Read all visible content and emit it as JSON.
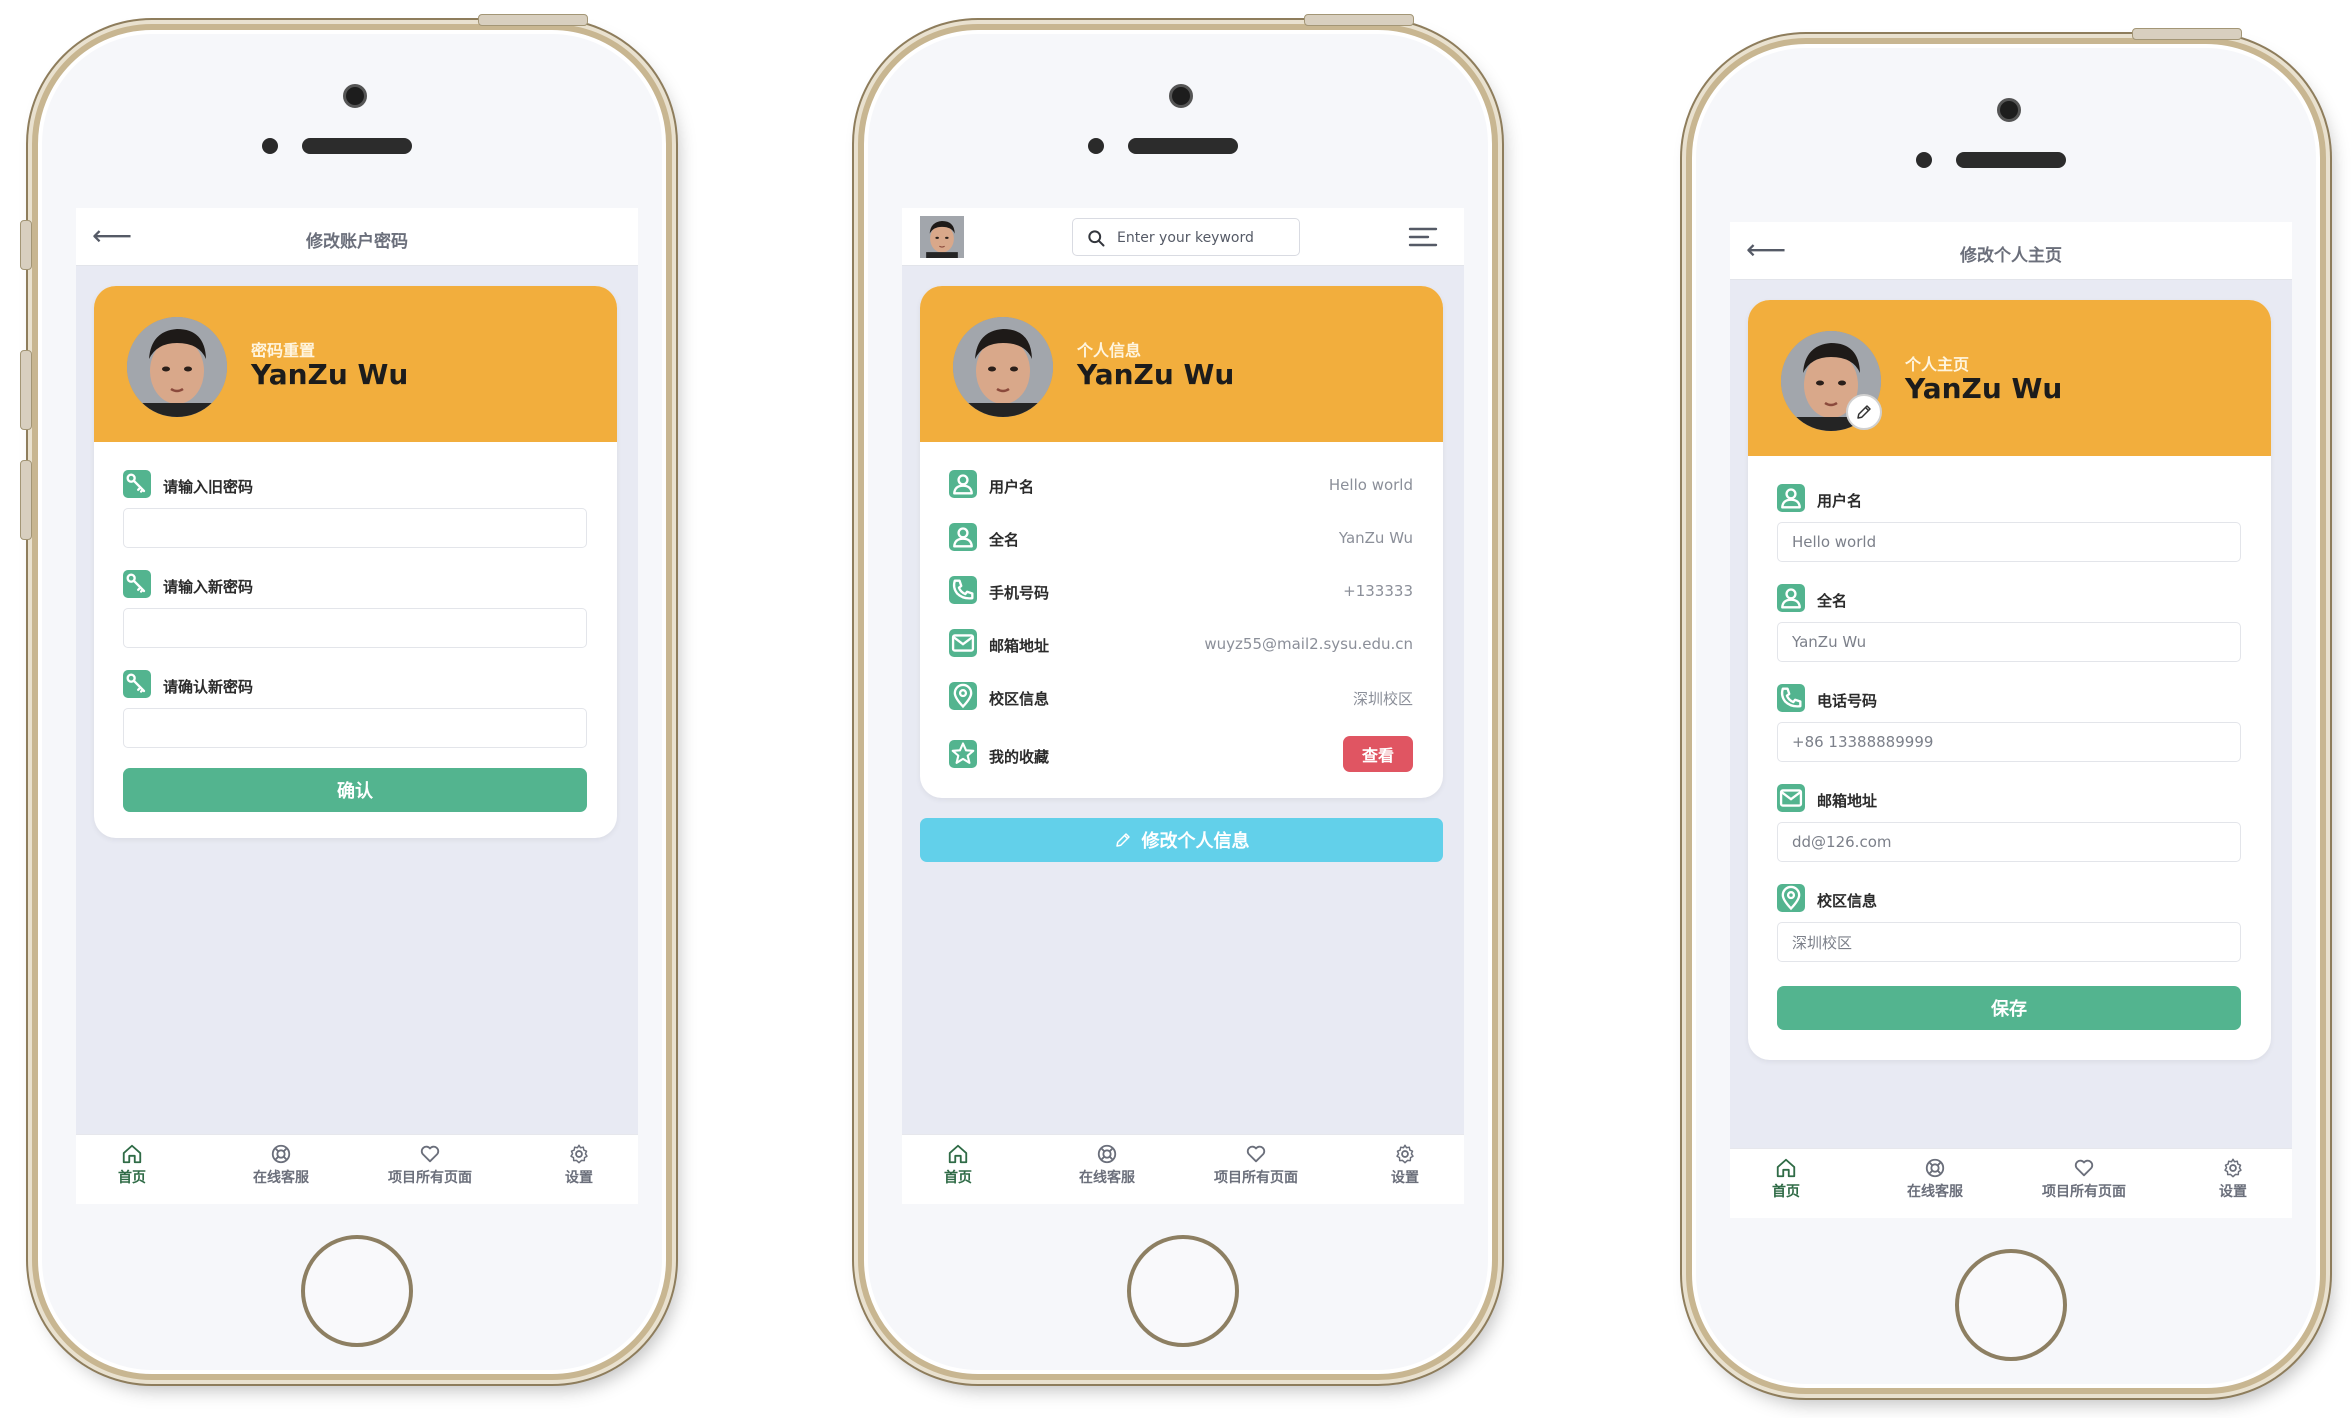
{
  "tabs": [
    {
      "label": "首页",
      "icon": "home-icon"
    },
    {
      "label": "在线客服",
      "icon": "support-icon"
    },
    {
      "label": "项目所有页面",
      "icon": "heart-icon"
    },
    {
      "label": "设置",
      "icon": "gear-icon"
    }
  ],
  "phone1": {
    "title": "修改账户密码",
    "header_sub": "密码重置",
    "name": "YanZu Wu",
    "fields": [
      {
        "label": "请输入旧密码",
        "value": ""
      },
      {
        "label": "请输入新密码",
        "value": ""
      },
      {
        "label": "请确认新密码",
        "value": ""
      }
    ],
    "confirm_label": "确认"
  },
  "phone2": {
    "search_placeholder": "Enter your keyword",
    "header_sub": "个人信息",
    "name": "YanZu Wu",
    "rows": [
      {
        "label": "用户名",
        "value": "Hello world",
        "icon": "user-icon"
      },
      {
        "label": "全名",
        "value": "YanZu Wu",
        "icon": "user-icon"
      },
      {
        "label": "手机号码",
        "value": "+133333",
        "icon": "phone-icon"
      },
      {
        "label": "邮箱地址",
        "value": "wuyz55@mail2.sysu.edu.cn",
        "icon": "mail-icon"
      },
      {
        "label": "校区信息",
        "value": "深圳校区",
        "icon": "location-icon"
      },
      {
        "label": "我的收藏",
        "value": "",
        "icon": "star-icon"
      }
    ],
    "view_label": "查看",
    "edit_label": "修改个人信息"
  },
  "phone3": {
    "title": "修改个人主页",
    "header_sub": "个人主页",
    "name": "YanZu Wu",
    "fields": [
      {
        "label": "用户名",
        "value": "Hello world",
        "icon": "user-icon"
      },
      {
        "label": "全名",
        "value": "YanZu Wu",
        "icon": "user-icon"
      },
      {
        "label": "电话号码",
        "value": "+86 13388889999",
        "icon": "phone-icon"
      },
      {
        "label": "邮箱地址",
        "value": "dd@126.com",
        "icon": "mail-icon"
      },
      {
        "label": "校区信息",
        "value": "深圳校区",
        "icon": "location-icon"
      }
    ],
    "save_label": "保存"
  },
  "colors": {
    "accent_orange": "#f2ae3d",
    "green": "#53b48f",
    "cyan": "#62d0ea",
    "red": "#e05562"
  }
}
